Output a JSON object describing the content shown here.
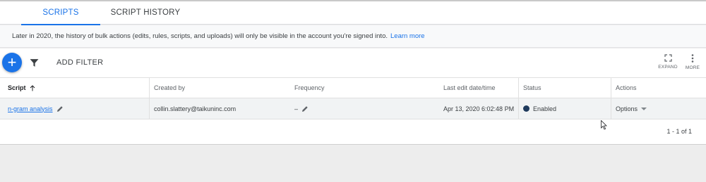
{
  "tabs": {
    "scripts": "SCRIPTS",
    "script_history": "SCRIPT HISTORY"
  },
  "banner": {
    "text": "Later in 2020, the history of bulk actions (edits, rules, scripts, and uploads) will only be visible in the account you're signed into.",
    "link": "Learn more"
  },
  "toolbar": {
    "add_icon": "+",
    "add_filter": "ADD FILTER",
    "expand_label": "EXPAND",
    "more_label": "MORE"
  },
  "table": {
    "headers": {
      "script": "Script",
      "created_by": "Created by",
      "frequency": "Frequency",
      "last_edit": "Last edit date/time",
      "status": "Status",
      "actions": "Actions"
    },
    "rows": [
      {
        "script": "n-gram analysis",
        "created_by": "collin.slattery@taikuninc.com",
        "frequency": "–",
        "last_edit": "Apr 13, 2020 6:02:48 PM",
        "status": "Enabled",
        "actions": "Options"
      }
    ]
  },
  "pagination": "1 - 1 of 1",
  "colors": {
    "accent": "#1a73e8",
    "status_enabled": "#1f3a5c"
  }
}
